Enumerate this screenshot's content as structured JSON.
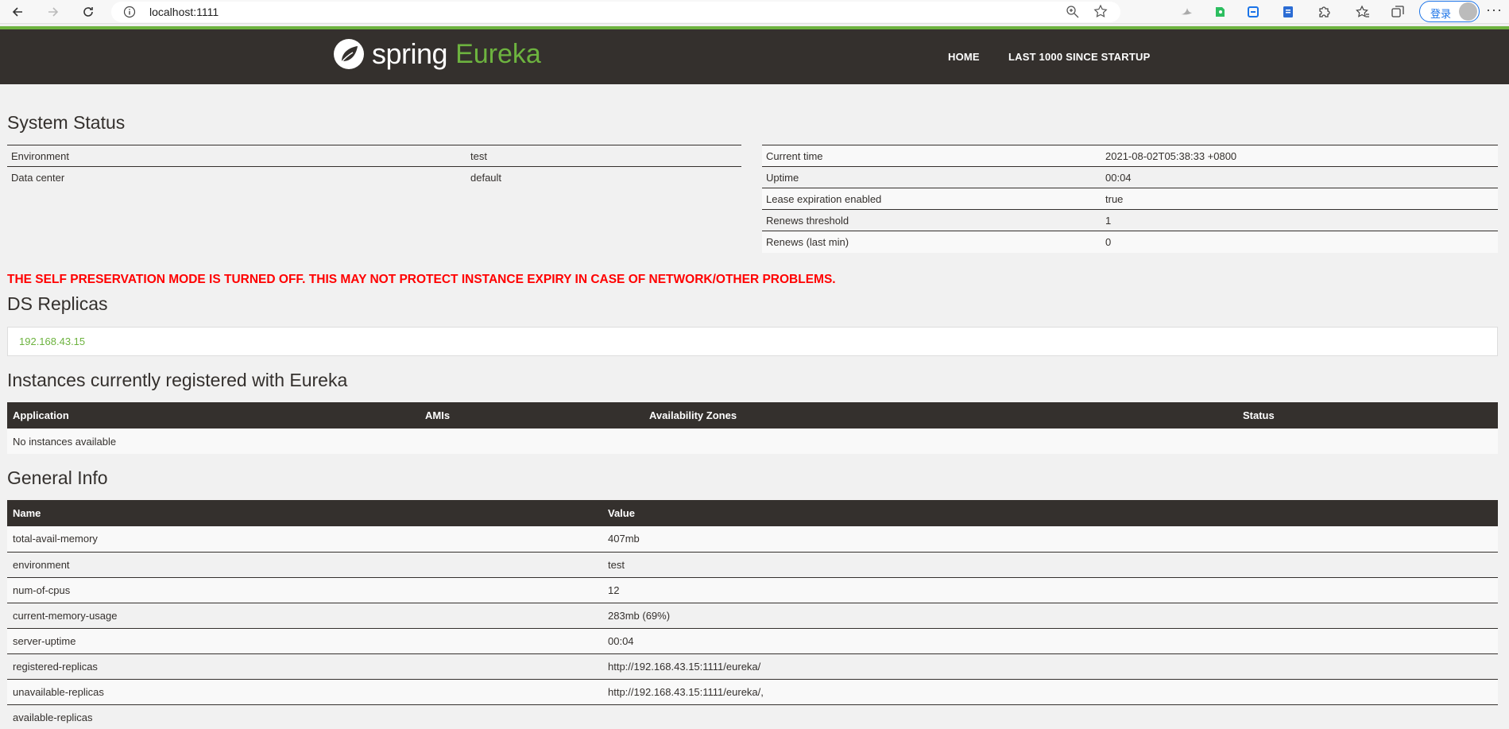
{
  "browser": {
    "url": "localhost:1111",
    "login_label": "登录",
    "more_label": "···"
  },
  "header": {
    "logo_spring": "spring",
    "logo_eureka": "Eureka",
    "nav": [
      "HOME",
      "LAST 1000 SINCE STARTUP"
    ]
  },
  "system_status": {
    "title": "System Status",
    "left": [
      {
        "label": "Environment",
        "value": "test"
      },
      {
        "label": "Data center",
        "value": "default"
      }
    ],
    "right": [
      {
        "label": "Current time",
        "value": "2021-08-02T05:38:33 +0800"
      },
      {
        "label": "Uptime",
        "value": "00:04"
      },
      {
        "label": "Lease expiration enabled",
        "value": "true"
      },
      {
        "label": "Renews threshold",
        "value": "1"
      },
      {
        "label": "Renews (last min)",
        "value": "0"
      }
    ]
  },
  "warning": "THE SELF PRESERVATION MODE IS TURNED OFF. THIS MAY NOT PROTECT INSTANCE EXPIRY IN CASE OF NETWORK/OTHER PROBLEMS.",
  "ds_replicas": {
    "title": "DS Replicas",
    "items": [
      "192.168.43.15"
    ]
  },
  "instances": {
    "title": "Instances currently registered with Eureka",
    "headers": [
      "Application",
      "AMIs",
      "Availability Zones",
      "Status"
    ],
    "empty": "No instances available"
  },
  "general_info": {
    "title": "General Info",
    "headers": [
      "Name",
      "Value"
    ],
    "rows": [
      {
        "name": "total-avail-memory",
        "value": "407mb"
      },
      {
        "name": "environment",
        "value": "test"
      },
      {
        "name": "num-of-cpus",
        "value": "12"
      },
      {
        "name": "current-memory-usage",
        "value": "283mb (69%)"
      },
      {
        "name": "server-uptime",
        "value": "00:04"
      },
      {
        "name": "registered-replicas",
        "value": "http://192.168.43.15:1111/eureka/"
      },
      {
        "name": "unavailable-replicas",
        "value": "http://192.168.43.15:1111/eureka/,"
      },
      {
        "name": "available-replicas",
        "value": ""
      }
    ]
  },
  "colors": {
    "brand_green": "#6db33f",
    "header_dark": "#34302d",
    "warning_red": "#ff0000"
  }
}
